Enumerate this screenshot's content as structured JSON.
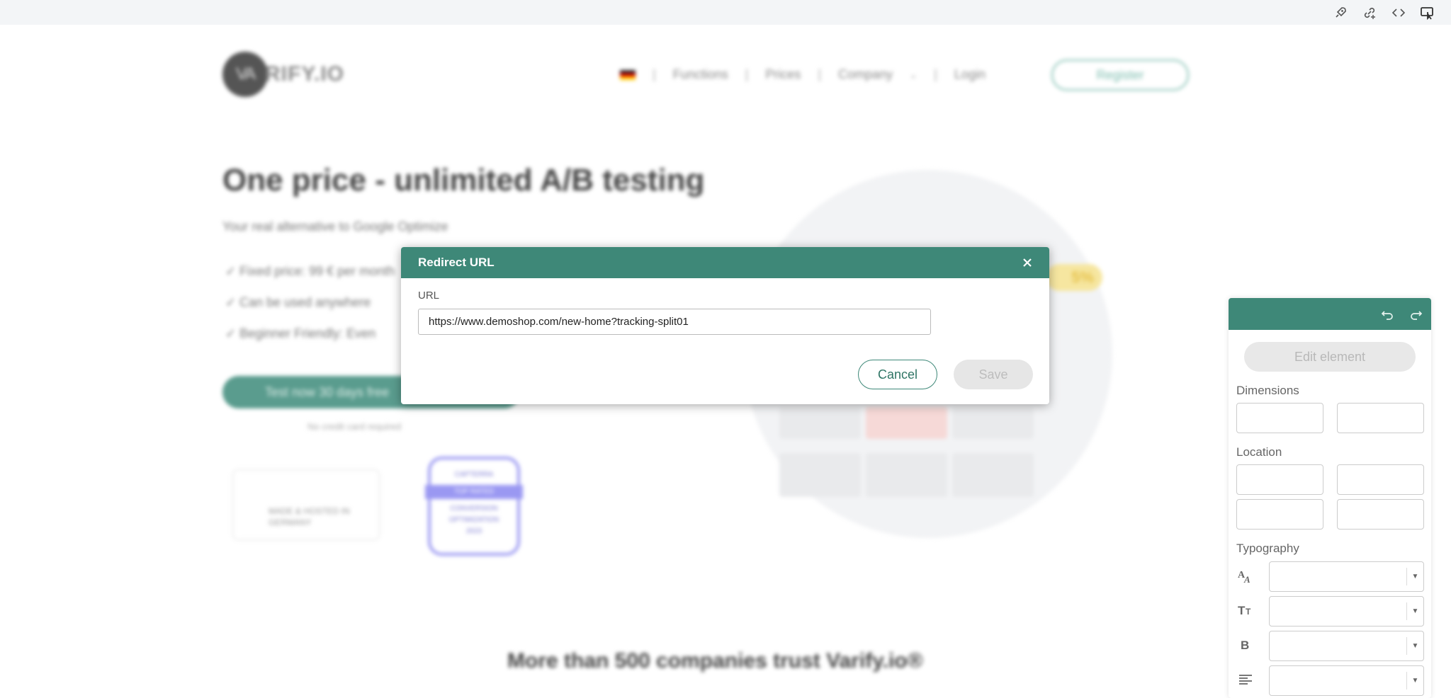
{
  "toolbar": {
    "icons": [
      "rocket-icon",
      "add-link-icon",
      "code-icon",
      "preview-icon"
    ]
  },
  "background_page": {
    "logo_mark": "VA",
    "logo_text": "RIFY.IO",
    "nav": [
      "Functions",
      "Prices",
      "Company",
      "Login"
    ],
    "register_label": "Register",
    "hero_title": "One price - unlimited A/B testing",
    "hero_subtitle": "Your real alternative to Google Optimize",
    "bullets": [
      "✓ Fixed price: 99 € per month",
      "✓ Can be used anywhere",
      "✓ Beginner Friendly: Even"
    ],
    "cta_label": "Test now 30 days free",
    "cta_note": "No credit card required",
    "badge1_text": "MADE & HOSTED IN GERMANY",
    "badge2_top": "CAPTERRA",
    "badge2_strip": "TOP RATED",
    "badge2_bottom": "CONVERSION OPTIMIZATION",
    "badge2_year": "2023",
    "pct_label": "5%",
    "trust_heading": "More than 500 companies trust Varify.io®"
  },
  "modal": {
    "title": "Redirect URL",
    "url_label": "URL",
    "url_value": "https://www.demoshop.com/new-home?tracking-split01",
    "cancel_label": "Cancel",
    "save_label": "Save"
  },
  "panel": {
    "edit_label": "Edit element",
    "dimensions_label": "Dimensions",
    "location_label": "Location",
    "typography_label": "Typography"
  },
  "colors": {
    "accent": "#3e8878",
    "save_disabled": "#e6e6e6"
  }
}
